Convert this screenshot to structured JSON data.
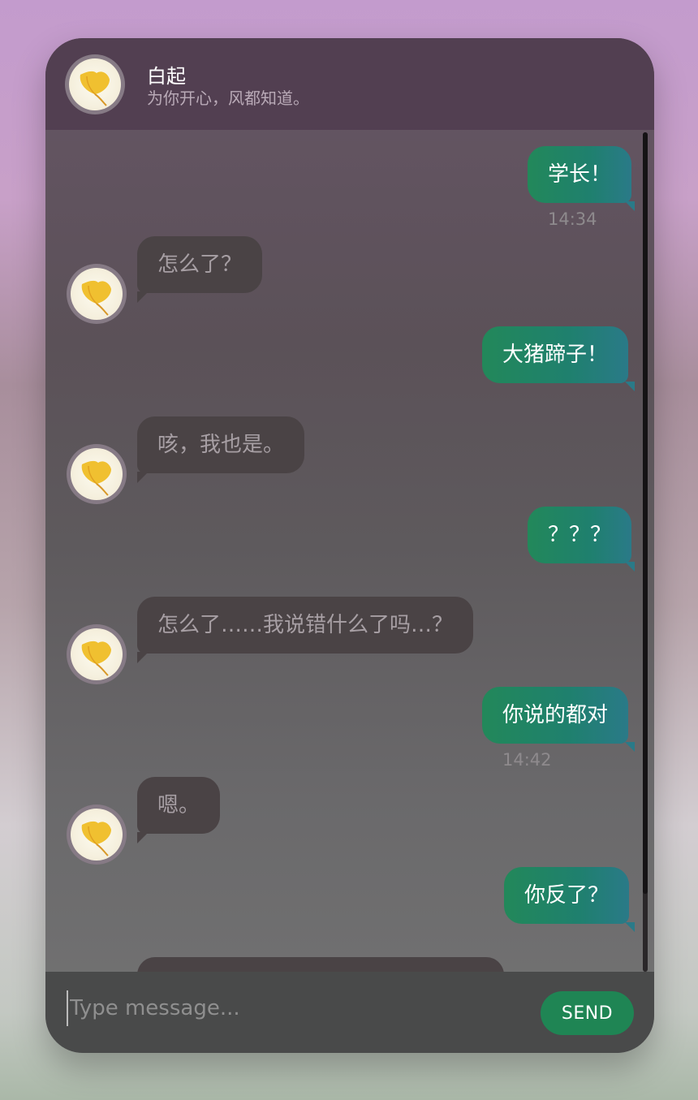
{
  "contact": {
    "name": "白起",
    "status": "为你开心，风都知道。",
    "avatar_icon": "ginkgo-leaf-icon"
  },
  "messages": [
    {
      "side": "out",
      "text": "学长！",
      "time": "14:34"
    },
    {
      "side": "in",
      "text": "怎么了？"
    },
    {
      "side": "out",
      "text": "大猪蹄子！"
    },
    {
      "side": "in",
      "text": "咳，我也是。"
    },
    {
      "side": "out",
      "text": "？？？"
    },
    {
      "side": "in",
      "text": "怎么了……我说错什么了吗…？"
    },
    {
      "side": "out",
      "text": "你说的都对",
      "time": "14:42"
    },
    {
      "side": "in",
      "text": "嗯。"
    },
    {
      "side": "out",
      "text": "你反了？"
    }
  ],
  "composer": {
    "placeholder": "Type message...",
    "send_label": "SEND"
  },
  "colors": {
    "outgoing_bubble": "#22885a",
    "incoming_bubble": "#4a4345",
    "send_button": "#1f8554",
    "header": "#523f51"
  }
}
